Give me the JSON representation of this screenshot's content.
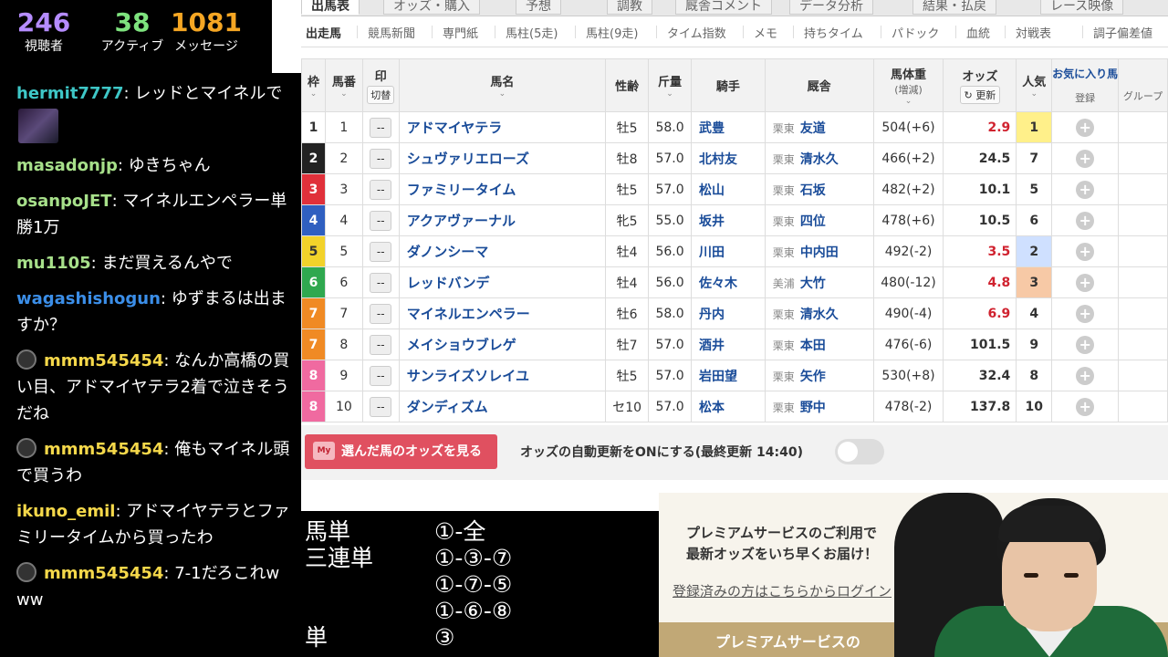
{
  "stats": [
    {
      "value": "246",
      "label": "視聴者",
      "color": "#b58cff"
    },
    {
      "value": "38",
      "label": "アクティブ",
      "color": "#7ee37e"
    },
    {
      "value": "1081",
      "label": "メッセージ",
      "color": "#f5a623"
    }
  ],
  "chat": [
    {
      "user": "hermit7777",
      "color": "#3ec7c7",
      "text": "レッドとマイネルで"
    },
    {
      "user": "masadonjp",
      "color": "#a7e08a",
      "text": "ゆきちゃん"
    },
    {
      "user": "osanpoJET",
      "color": "#a7e08a",
      "text": "マイネルエンペラー単勝1万"
    },
    {
      "user": "mu1105",
      "color": "#a7e08a",
      "text": "まだ買えるんやで"
    },
    {
      "user": "wagashishogun",
      "color": "#3b8ee8",
      "text": "ゆずまるは出ますか？"
    },
    {
      "user": "mmm545454",
      "color": "#f5d84a",
      "text": "なんか高橋の買い目、アドマイヤテラ2着で泣きそうだね"
    },
    {
      "user": "mmm545454",
      "color": "#f5d84a",
      "text": "俺もマイネル頭で買うわ"
    },
    {
      "user": "ikuno_emil",
      "color": "#f5d84a",
      "text": "アドマイヤテラとファミリータイムから買ったわ"
    },
    {
      "user": "mmm545454",
      "color": "#f5d84a",
      "text": "7-1だろこれwww"
    }
  ],
  "page_tabs": [
    "出馬表",
    "オッズ・購入",
    "予想",
    "調教",
    "厩舎コメント",
    "データ分析",
    "結果・払戻",
    "レース映像"
  ],
  "subnav": [
    "出走馬",
    "競馬新聞",
    "専門紙",
    "馬柱(5走)",
    "馬柱(9走)",
    "タイム指数",
    "メモ",
    "持ちタイム",
    "パドック",
    "血統",
    "対戦表",
    "調子偏差値"
  ],
  "table": {
    "headers": {
      "waku": "枠",
      "umaban": "馬番",
      "mark": "印",
      "mark_sub": "切替",
      "name": "馬名",
      "sexage": "性齢",
      "weight": "斤量",
      "jockey": "騎手",
      "stable": "厩舎",
      "bodyweight": "馬体重",
      "bodyweight_sub": "(増減)",
      "odds": "オッズ",
      "odds_refresh": "更新",
      "popularity": "人気",
      "fav": "お気に入り馬",
      "fav_reg": "登録",
      "fav_group": "グループ"
    },
    "rows": [
      {
        "waku": "1",
        "umaban": "1",
        "mark": "--",
        "name": "アドマイヤテラ",
        "sexage": "牡5",
        "weight": "58.0",
        "jockey": "武豊",
        "region": "栗東",
        "trainer": "友道",
        "bodyweight": "504(+6)",
        "odds": "2.9",
        "pop": "1"
      },
      {
        "waku": "2",
        "umaban": "2",
        "mark": "--",
        "name": "シュヴァリエローズ",
        "sexage": "牡8",
        "weight": "57.0",
        "jockey": "北村友",
        "region": "栗東",
        "trainer": "清水久",
        "bodyweight": "466(+2)",
        "odds": "24.5",
        "pop": "7"
      },
      {
        "waku": "3",
        "umaban": "3",
        "mark": "--",
        "name": "ファミリータイム",
        "sexage": "牡5",
        "weight": "57.0",
        "jockey": "松山",
        "region": "栗東",
        "trainer": "石坂",
        "bodyweight": "482(+2)",
        "odds": "10.1",
        "pop": "5"
      },
      {
        "waku": "4",
        "umaban": "4",
        "mark": "--",
        "name": "アクアヴァーナル",
        "sexage": "牝5",
        "weight": "55.0",
        "jockey": "坂井",
        "region": "栗東",
        "trainer": "四位",
        "bodyweight": "478(+6)",
        "odds": "10.5",
        "pop": "6"
      },
      {
        "waku": "5",
        "umaban": "5",
        "mark": "--",
        "name": "ダノンシーマ",
        "sexage": "牡4",
        "weight": "56.0",
        "jockey": "川田",
        "region": "栗東",
        "trainer": "中内田",
        "bodyweight": "492(-2)",
        "odds": "3.5",
        "pop": "2"
      },
      {
        "waku": "6",
        "umaban": "6",
        "mark": "--",
        "name": "レッドバンデ",
        "sexage": "牡4",
        "weight": "56.0",
        "jockey": "佐々木",
        "region": "美浦",
        "trainer": "大竹",
        "bodyweight": "480(-12)",
        "odds": "4.8",
        "pop": "3"
      },
      {
        "waku": "7",
        "umaban": "7",
        "mark": "--",
        "name": "マイネルエンペラー",
        "sexage": "牡6",
        "weight": "58.0",
        "jockey": "丹内",
        "region": "栗東",
        "trainer": "清水久",
        "bodyweight": "490(-4)",
        "odds": "6.9",
        "pop": "4"
      },
      {
        "waku": "7",
        "umaban": "8",
        "mark": "--",
        "name": "メイショウブレゲ",
        "sexage": "牡7",
        "weight": "57.0",
        "jockey": "酒井",
        "region": "栗東",
        "trainer": "本田",
        "bodyweight": "476(-6)",
        "odds": "101.5",
        "pop": "9"
      },
      {
        "waku": "8",
        "umaban": "9",
        "mark": "--",
        "name": "サンライズソレイユ",
        "sexage": "牡5",
        "weight": "57.0",
        "jockey": "岩田望",
        "region": "栗東",
        "trainer": "矢作",
        "bodyweight": "530(+8)",
        "odds": "32.4",
        "pop": "8"
      },
      {
        "waku": "8",
        "umaban": "10",
        "mark": "--",
        "name": "ダンディズム",
        "sexage": "セ10",
        "weight": "57.0",
        "jockey": "松本",
        "region": "栗東",
        "trainer": "野中",
        "bodyweight": "478(-2)",
        "odds": "137.8",
        "pop": "10"
      }
    ]
  },
  "waku_colors": {
    "1": "#ffffff",
    "2": "#222222",
    "3": "#e0303a",
    "4": "#2f5fc0",
    "5": "#f2d22a",
    "6": "#2fa84f",
    "7": "#f08a24",
    "8": "#f06aa0"
  },
  "pop_colors": {
    "1": "#fff08a",
    "2": "#cfe0ff",
    "3": "#f7c9a6"
  },
  "footer": {
    "odds_button": "選んだ馬のオッズを見る",
    "odds_button_icon": "My",
    "auto_update": "オッズの自動更新をONにする(最終更新 14:40)"
  },
  "bets": [
    {
      "kind": "馬単",
      "combo": "①-全"
    },
    {
      "kind": "三連単",
      "combo": "①-③-⑦"
    },
    {
      "kind": "",
      "combo": "①-⑦-⑤"
    },
    {
      "kind": "",
      "combo": "①-⑥-⑧"
    },
    {
      "kind": "単",
      "combo": "③"
    }
  ],
  "premium": {
    "line1": "プレミアムサービスのご利用で",
    "line2": "最新オッズをいち早くお届け！",
    "login": "登録済みの方はこちらからログイン",
    "band": "プレミアムサービスの"
  }
}
